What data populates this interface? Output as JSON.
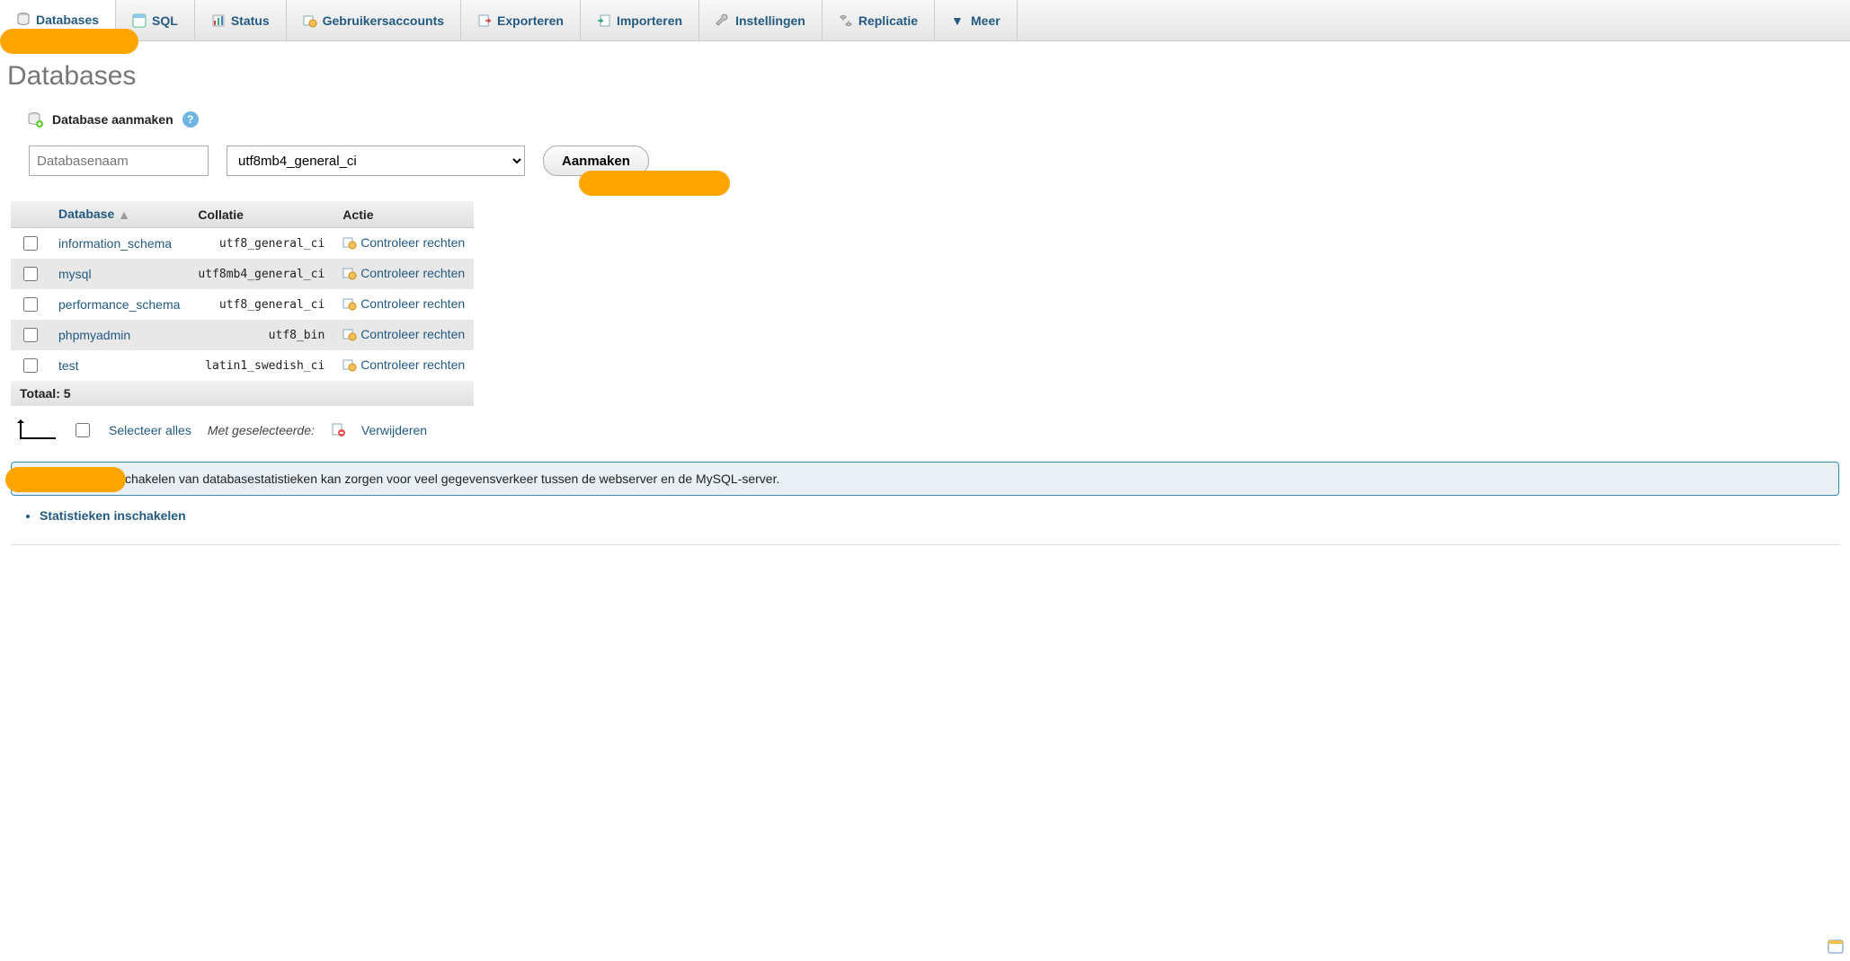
{
  "tabs": {
    "databases": "Databases",
    "sql": "SQL",
    "status": "Status",
    "users": "Gebruikersaccounts",
    "export": "Exporteren",
    "import": "Importeren",
    "settings": "Instellingen",
    "replication": "Replicatie",
    "more": "Meer"
  },
  "page_title": "Databases",
  "create": {
    "heading": "Database aanmaken",
    "name_placeholder": "Databasenaam",
    "collation_selected": "utf8mb4_general_ci",
    "button": "Aanmaken"
  },
  "table": {
    "headers": {
      "database": "Database",
      "collation": "Collatie",
      "action": "Actie"
    },
    "action_label": "Controleer rechten",
    "rows": [
      {
        "name": "information_schema",
        "collation": "utf8_general_ci"
      },
      {
        "name": "mysql",
        "collation": "utf8mb4_general_ci"
      },
      {
        "name": "performance_schema",
        "collation": "utf8_general_ci"
      },
      {
        "name": "phpmyadmin",
        "collation": "utf8_bin"
      },
      {
        "name": "test",
        "collation": "latin1_swedish_ci"
      }
    ],
    "total_label": "Totaal: 5"
  },
  "below": {
    "select_all": "Selecteer alles",
    "with_selected": "Met geselecteerde:",
    "delete": "Verwijderen"
  },
  "notice": "Let op: het inschakelen van databasestatistieken kan zorgen voor veel gegevensverkeer tussen de webserver en de MySQL-server.",
  "enable_stats": "Statistieken inschakelen"
}
